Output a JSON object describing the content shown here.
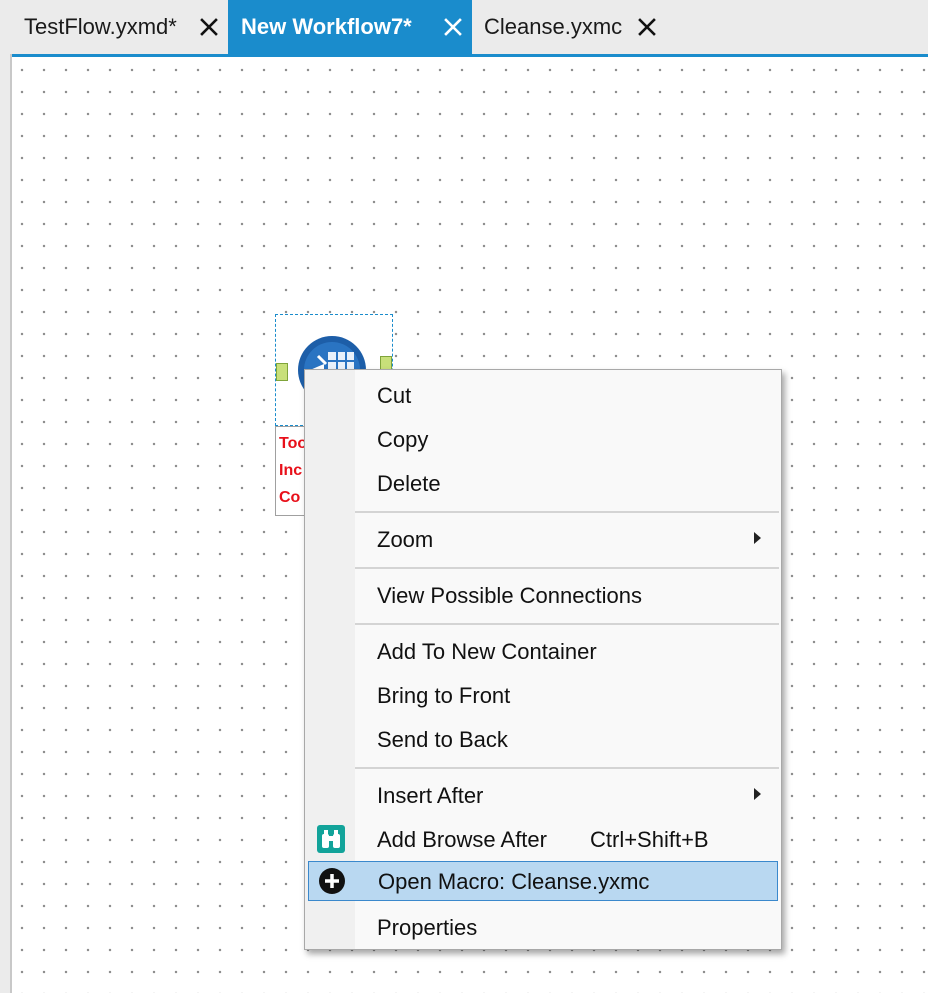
{
  "tabs": [
    {
      "label": "TestFlow.yxmd*",
      "active": false
    },
    {
      "label": "New Workflow7*",
      "active": true
    },
    {
      "label": "Cleanse.yxmc",
      "active": false
    }
  ],
  "colors": {
    "accent": "#1a8ccc",
    "tool_label_text": "#e8101a",
    "menu_highlight": "#b9d8f1"
  },
  "canvas": {
    "tool": {
      "icon": "macro-tool-icon",
      "label_lines": [
        "Too",
        "Inc",
        "Co"
      ]
    }
  },
  "context_menu": {
    "items": [
      {
        "label": "Cut"
      },
      {
        "label": "Copy"
      },
      {
        "label": "Delete"
      },
      {
        "label": "Zoom",
        "submenu": true
      },
      {
        "label": "View Possible Connections"
      },
      {
        "label": "Add To New Container"
      },
      {
        "label": "Bring to Front"
      },
      {
        "label": "Send to Back"
      },
      {
        "label": "Insert After",
        "submenu": true
      },
      {
        "label": "Add Browse After",
        "shortcut": "Ctrl+Shift+B",
        "icon": "binoculars-icon"
      },
      {
        "label": "Open Macro: Cleanse.yxmc",
        "icon": "plus-circle-icon",
        "highlighted": true
      },
      {
        "label": "Properties"
      }
    ]
  }
}
